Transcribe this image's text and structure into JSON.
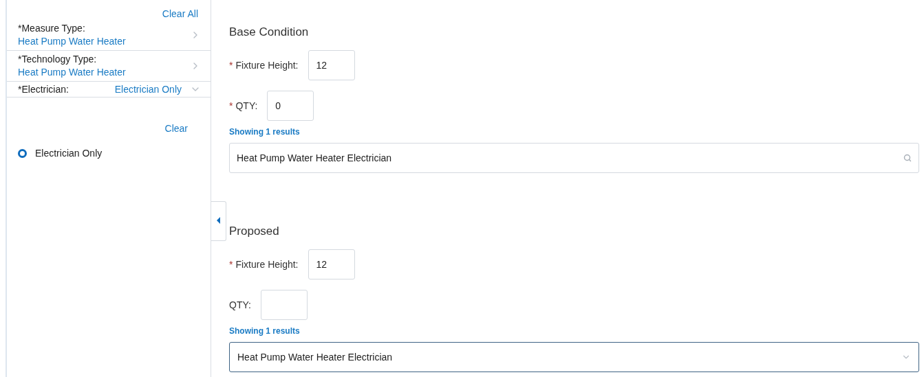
{
  "filter_panel": {
    "clear_all": "Clear All",
    "filters": [
      {
        "kind": "drill",
        "label": "*Measure Type:",
        "value": "Heat Pump Water Heater"
      },
      {
        "kind": "drill",
        "label": "*Technology Type:",
        "value": "Heat Pump Water Heater"
      },
      {
        "kind": "dropdown",
        "label": "*Electrician:",
        "value": "Electrician Only"
      }
    ],
    "clear": "Clear",
    "options": [
      {
        "label": "Electrician Only",
        "selected": true
      }
    ]
  },
  "sections": [
    {
      "title": "Base Condition",
      "fields": [
        {
          "required_mark": "*",
          "label": "Fixture Height:",
          "value": "12"
        },
        {
          "required_mark": "*",
          "label": "QTY:",
          "value": "0"
        }
      ],
      "results_count": "Showing 1 results",
      "result_field": {
        "kind": "search",
        "value": "Heat Pump Water Heater Electrician"
      }
    },
    {
      "title": "Proposed",
      "fields": [
        {
          "required_mark": "*",
          "label": "Fixture Height:",
          "value": "12"
        },
        {
          "label": "QTY:"
        }
      ],
      "results_count": "Showing 1 results",
      "result_field": {
        "kind": "select",
        "value": "Heat Pump Water Heater Electrician"
      }
    }
  ]
}
